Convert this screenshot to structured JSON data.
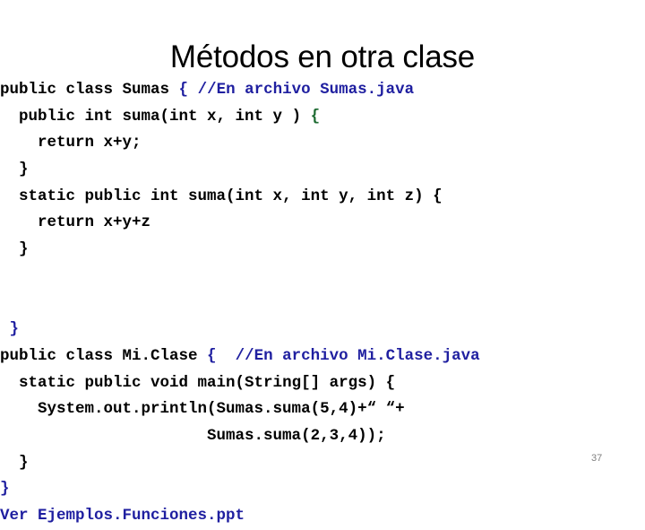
{
  "slide": {
    "title": "Métodos en otra clase",
    "page_number": "37",
    "colors": {
      "text": "#000000",
      "comment": "#1F1FA0",
      "brace_green": "#1E6B32",
      "page_number": "#808080",
      "background": "#ffffff"
    }
  },
  "code": {
    "lines": [
      {
        "indent": "",
        "segments": [
          {
            "text": "public class Sumas ",
            "color": "black"
          },
          {
            "text": "{ ",
            "color": "blue"
          },
          {
            "text": "//En archivo Sumas.java",
            "color": "blue"
          }
        ]
      },
      {
        "indent": "  ",
        "segments": [
          {
            "text": "public int suma(int x, int y ) ",
            "color": "black"
          },
          {
            "text": "{",
            "color": "green"
          }
        ]
      },
      {
        "indent": "    ",
        "segments": [
          {
            "text": "return x+y;",
            "color": "black"
          }
        ]
      },
      {
        "indent": "  ",
        "segments": [
          {
            "text": "}",
            "color": "black"
          }
        ]
      },
      {
        "indent": "  ",
        "segments": [
          {
            "text": "static public int suma(int x, int y, int z) {",
            "color": "black"
          }
        ]
      },
      {
        "indent": "    ",
        "segments": [
          {
            "text": "return x+y+z",
            "color": "black"
          }
        ]
      },
      {
        "indent": "  ",
        "segments": [
          {
            "text": "}",
            "color": "black"
          }
        ]
      },
      {
        "indent": "",
        "segments": [
          {
            "text": "",
            "color": "black"
          }
        ]
      },
      {
        "indent": "",
        "segments": [
          {
            "text": "",
            "color": "black"
          }
        ]
      },
      {
        "indent": " ",
        "segments": [
          {
            "text": "}",
            "color": "blue"
          }
        ]
      },
      {
        "indent": "",
        "segments": [
          {
            "text": "public class Mi.Clase ",
            "color": "black"
          },
          {
            "text": "{  ",
            "color": "blue"
          },
          {
            "text": "//En archivo Mi.Clase.java",
            "color": "blue"
          }
        ]
      },
      {
        "indent": "  ",
        "segments": [
          {
            "text": "static public void main(String[] args) {",
            "color": "black"
          }
        ]
      },
      {
        "indent": "    ",
        "segments": [
          {
            "text": "System.out.println(Sumas.suma(5,4)+“ “+",
            "color": "black"
          }
        ]
      },
      {
        "indent": "                      ",
        "segments": [
          {
            "text": "Sumas.suma(2,3,4));",
            "color": "black"
          }
        ]
      },
      {
        "indent": "  ",
        "segments": [
          {
            "text": "}",
            "color": "black"
          }
        ]
      },
      {
        "indent": "",
        "segments": [
          {
            "text": "}",
            "color": "blue"
          }
        ]
      },
      {
        "indent": "",
        "segments": [
          {
            "text": "Ver Ejemplos.Funciones.ppt",
            "color": "blue"
          }
        ]
      }
    ]
  }
}
